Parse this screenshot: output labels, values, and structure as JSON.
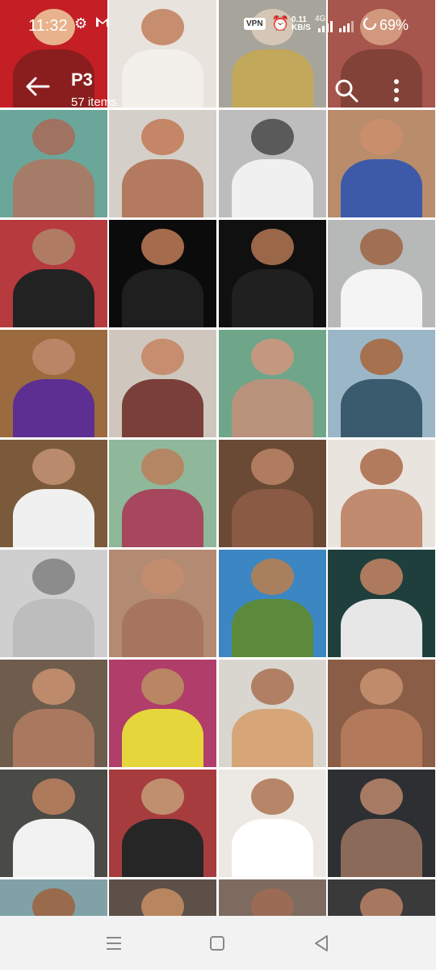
{
  "status_bar": {
    "time": "11:32",
    "icons": [
      "gear-icon",
      "gmail-icon"
    ],
    "vpn": "VPN",
    "net_speed": "0.11",
    "net_unit": "KB/S",
    "network": "4G",
    "battery": "69%"
  },
  "header": {
    "title": "P3",
    "count": "57 items"
  },
  "nav": {
    "buttons": [
      "recents-button",
      "home-button",
      "back-button"
    ]
  },
  "photos": [
    {
      "bg": "#c41f25",
      "fg1": "#e8b28c",
      "fg2": "#8a1e1e"
    },
    {
      "bg": "#e9e3de",
      "fg1": "#c68d6f",
      "fg2": "#f3f0ec"
    },
    {
      "bg": "#a7a49b",
      "fg1": "#d6c6b5",
      "fg2": "#c2a85a"
    },
    {
      "bg": "#a6564c",
      "fg1": "#d2987e",
      "fg2": "#824238"
    },
    {
      "bg": "#6aa79a",
      "fg1": "#9f7262",
      "fg2": "#a57c68"
    },
    {
      "bg": "#d4d0c9",
      "fg1": "#c48667",
      "fg2": "#b37a5f"
    },
    {
      "bg": "#bdbdbd",
      "fg1": "#5a5a5a",
      "fg2": "#f0f0f0"
    },
    {
      "bg": "#b98c6b",
      "fg1": "#c98e6c",
      "fg2": "#3d5aa8"
    },
    {
      "bg": "#b63a3e",
      "fg1": "#b07b63",
      "fg2": "#222222"
    },
    {
      "bg": "#0b0b0b",
      "fg1": "#a46b4c",
      "fg2": "#1f1f1f"
    },
    {
      "bg": "#101010",
      "fg1": "#9b6749",
      "fg2": "#202020"
    },
    {
      "bg": "#b7b8b8",
      "fg1": "#a06f54",
      "fg2": "#f4f4f4"
    },
    {
      "bg": "#9b6a3f",
      "fg1": "#b98566",
      "fg2": "#5d2f92"
    },
    {
      "bg": "#cfc7bd",
      "fg1": "#c68e6f",
      "fg2": "#7a3f3a"
    },
    {
      "bg": "#6fa68a",
      "fg1": "#c49880",
      "fg2": "#b9927c"
    },
    {
      "bg": "#9bb6c7",
      "fg1": "#a5714f",
      "fg2": "#3a5a6e"
    },
    {
      "bg": "#7a5a3a",
      "fg1": "#b98a6b",
      "fg2": "#f0f0f0"
    },
    {
      "bg": "#8fb79a",
      "fg1": "#b58663",
      "fg2": "#a6475e"
    },
    {
      "bg": "#6a4a35",
      "fg1": "#b07c5f",
      "fg2": "#8a5a44"
    },
    {
      "bg": "#e9e4de",
      "fg1": "#b27b5e",
      "fg2": "#c08b6e"
    },
    {
      "bg": "#cfcfcf",
      "fg1": "#8c8c8c",
      "fg2": "#bdbdbd"
    },
    {
      "bg": "#b38a72",
      "fg1": "#c28d6e",
      "fg2": "#a7755d"
    },
    {
      "bg": "#3c87c3",
      "fg1": "#a9805e",
      "fg2": "#5c8a3d"
    },
    {
      "bg": "#1f3f3d",
      "fg1": "#ad7a5d",
      "fg2": "#e7e7e7"
    },
    {
      "bg": "#6e5c4c",
      "fg1": "#bd8a6b",
      "fg2": "#a9785e"
    },
    {
      "bg": "#b03d6a",
      "fg1": "#b98663",
      "fg2": "#e5d63b"
    },
    {
      "bg": "#d9d6d0",
      "fg1": "#b07f64",
      "fg2": "#d6a678"
    },
    {
      "bg": "#8a5d46",
      "fg1": "#c08b6b",
      "fg2": "#b27a5b"
    },
    {
      "bg": "#4a4a46",
      "fg1": "#ad7a5c",
      "fg2": "#f2f2f2"
    },
    {
      "bg": "#a73c3e",
      "fg1": "#c08f70",
      "fg2": "#262626"
    },
    {
      "bg": "#ece8e3",
      "fg1": "#b78567",
      "fg2": "#ffffff"
    },
    {
      "bg": "#2d2f33",
      "fg1": "#a77a64",
      "fg2": "#8c6a5a"
    },
    {
      "bg": "#7fa1a7",
      "fg1": "#9a6a4c",
      "fg2": "#3b3b3b"
    },
    {
      "bg": "#5c5048",
      "fg1": "#b7855f",
      "fg2": "#d9d9d9"
    },
    {
      "bg": "#7d6b60",
      "fg1": "#9c6b55",
      "fg2": "#2a2a2a"
    },
    {
      "bg": "#3a3a3a",
      "fg1": "#a7775f",
      "fg2": "#cfcfcf"
    }
  ]
}
